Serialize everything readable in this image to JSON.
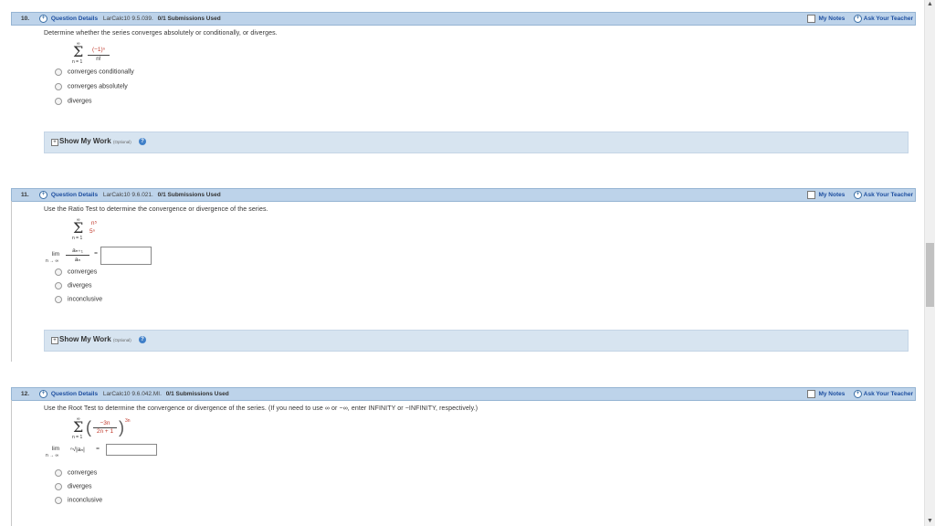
{
  "common": {
    "details_label": "Question Details",
    "my_notes": "My Notes",
    "ask_teacher": "Ask Your Teacher",
    "show_my_work": "Show My Work",
    "optional": "(Optional)",
    "help_glyph": "?",
    "expand_glyph": "+"
  },
  "questions": [
    {
      "number": "10.",
      "source": "LarCalc10 9.5.039.",
      "submissions": "0/1 Submissions Used",
      "prompt": "Determine whether the series converges absolutely or conditionally, or diverges.",
      "math": {
        "sum_top": "∞",
        "sum_bottom": "n = 1",
        "numerator": "(−1)ⁿ",
        "denominator": "n!"
      },
      "options": [
        "converges conditionally",
        "converges absolutely",
        "diverges"
      ]
    },
    {
      "number": "11.",
      "source": "LarCalc10 9.6.021.",
      "submissions": "0/1 Submissions Used",
      "prompt": "Use the Ratio Test to determine the convergence or divergence of the series.",
      "math": {
        "sum_top": "∞",
        "sum_bottom": "n = 1",
        "term_top": "n⁵",
        "term_bottom": "5ⁿ",
        "lim": "lim",
        "lim_sub": "n → ∞",
        "ratio_top": "aₙ₊₁",
        "ratio_bottom": "aₙ",
        "equals": "="
      },
      "options": [
        "converges",
        "diverges",
        "inconclusive"
      ]
    },
    {
      "number": "12.",
      "source": "LarCalc10 9.6.042.MI.",
      "submissions": "0/1 Submissions Used",
      "prompt": "Use the Root Test to determine the convergence or divergence of the series. (If you need to use ∞ or −∞, enter INFINITY or −INFINITY, respectively.)",
      "math": {
        "sum_top": "∞",
        "sum_bottom": "n = 1",
        "frac_top": "−3n",
        "frac_bottom": "2n + 1",
        "exponent": "3n",
        "lim": "lim",
        "lim_sub": "n → ∞",
        "root": "ⁿ√|aₙ|",
        "equals": "="
      },
      "options": [
        "converges",
        "diverges",
        "inconclusive"
      ]
    }
  ]
}
